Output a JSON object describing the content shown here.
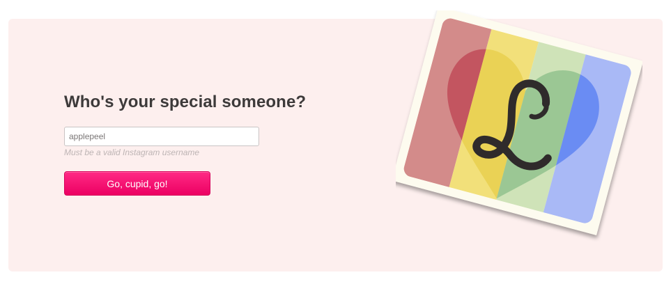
{
  "form": {
    "heading": "Who's your special someone?",
    "username_value": "applepeel",
    "hint": "Must be a valid Instagram username",
    "submit_label": "Go, cupid, go!"
  },
  "logo": {
    "letter": "L",
    "stripe_colors": [
      "#d8534f",
      "#f1c40f",
      "#8bc34a",
      "#4b7bf5"
    ],
    "photo_frame": "#fdfbef",
    "icon": "rainbow-heart-logo"
  },
  "colors": {
    "card_background": "#fdefee",
    "button": "#ff0a73",
    "heading_text": "#3d3a3a",
    "hint_text": "#bdb4b4"
  }
}
